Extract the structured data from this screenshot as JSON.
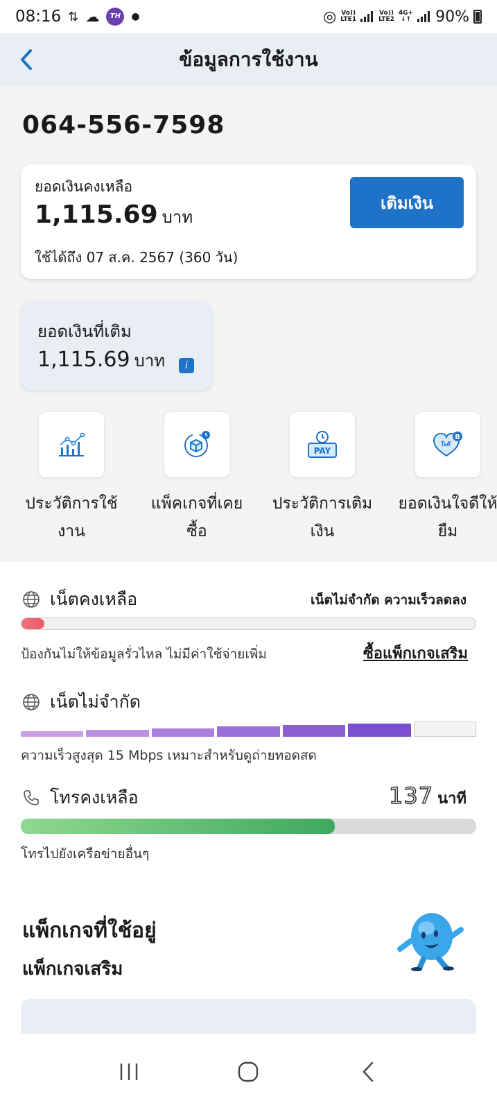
{
  "status_bar": {
    "time": "08:16",
    "carrier_logo": "TH",
    "battery": "90%",
    "lte1": "LTE1",
    "lte2": "LTE2",
    "net": "4G+"
  },
  "header": {
    "title": "ข้อมูลการใช้งาน",
    "back_icon": "chevron-left-icon"
  },
  "account": {
    "phone_number": "064-556-7598"
  },
  "balance": {
    "label": "ยอดเงินคงเหลือ",
    "amount": "1,115.69",
    "unit": "บาท",
    "valid_until": "ใช้ได้ถึง 07 ส.ค. 2567 (360 วัน)",
    "topup_button": "เติมเงิน"
  },
  "topup_amount": {
    "label": "ยอดเงินที่เติม",
    "amount": "1,115.69",
    "unit": "บาท"
  },
  "menu": [
    {
      "label": "ประวัติการใช้งาน",
      "icon": "usage-chart-icon"
    },
    {
      "label": "แพ็คเกจที่เคยซื้อ",
      "icon": "package-history-icon"
    },
    {
      "label": "ประวัติการเติมเงิน",
      "icon": "pay-history-icon"
    },
    {
      "label": "ยอดเงินใจดีให้ยืม",
      "icon": "heart-loan-icon"
    }
  ],
  "internet_remaining": {
    "title": "เน็ตคงเหลือ",
    "note": "เน็ตไม่จำกัด ความเร็วลดลง",
    "progress": 0.05,
    "desc": "ป้องกันไม่ให้ข้อมูลรั่วไหล ไม่มีค่าใช้จ่ายเพิ่ม",
    "link": "ซื้อแพ็กเกจเสริม"
  },
  "unlimited": {
    "title": "เน็ตไม่จำกัด",
    "desc": "ความเร็วสูงสุด 15 Mbps เหมาะสำหรับดูถ่ายทอดสด",
    "filled_segments": 6,
    "total_segments": 7
  },
  "call": {
    "title": "โทรคงเหลือ",
    "minutes": "137",
    "minutes_unit": "นาที",
    "progress": 0.69,
    "desc": "โทรไปยังเครือข่ายอื่นๆ"
  },
  "packages": {
    "title": "แพ็กเกจที่ใช้อยู่",
    "subtitle": "แพ็กเกจเสริม"
  },
  "colors": {
    "primary": "#1e73c8",
    "header_bg": "#e9eef4",
    "call_bar_start": "#8fd88f",
    "call_bar_end": "#3fa85f",
    "unlimited_start": "#c9a0e6",
    "unlimited_end": "#7a4fd0",
    "remaining_bar": "#e85a6a"
  }
}
